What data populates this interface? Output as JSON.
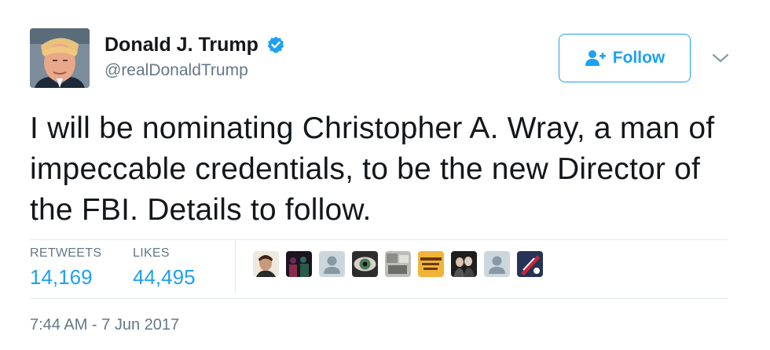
{
  "user": {
    "display_name": "Donald J. Trump",
    "handle": "@realDonaldTrump",
    "verified_icon": "verified-badge-icon",
    "verified_color": "#1da1f2"
  },
  "follow": {
    "label": "Follow",
    "icon": "add-user-icon",
    "color": "#1da1f2"
  },
  "menu": {
    "icon": "chevron-down-icon"
  },
  "tweet": {
    "text": "I will be nominating Christopher A. Wray, a man of impeccable credentials, to be the new Director of the FBI. Details to follow."
  },
  "stats": {
    "retweets_label": "RETWEETS",
    "retweets_value": "14,169",
    "likes_label": "LIKES",
    "likes_value": "44,495"
  },
  "likers": [
    {
      "icon": "profile-photo"
    },
    {
      "icon": "profile-photo"
    },
    {
      "icon": "default-avatar-icon"
    },
    {
      "icon": "eye-photo"
    },
    {
      "icon": "profile-photo"
    },
    {
      "icon": "sign-photo"
    },
    {
      "icon": "profile-photo"
    },
    {
      "icon": "default-avatar-icon"
    },
    {
      "icon": "flag-photo"
    }
  ],
  "timestamp": "7:44 AM - 7 Jun 2017"
}
